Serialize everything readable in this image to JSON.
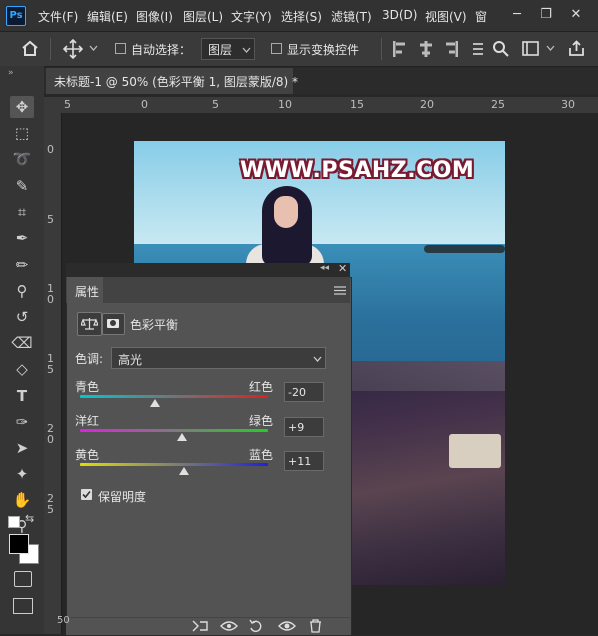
{
  "app": {
    "logo": "Ps"
  },
  "menu": [
    "文件(F)",
    "编辑(E)",
    "图像(I)",
    "图层(L)",
    "文字(Y)",
    "选择(S)",
    "滤镜(T)",
    "3D(D)",
    "视图(V)",
    "窗"
  ],
  "window_controls": {
    "minimize": "─",
    "restore": "❐",
    "close": "✕"
  },
  "options": {
    "auto_select_label": "自动选择：",
    "auto_select_target": "图层",
    "show_transform_label": "显示变换控件"
  },
  "document": {
    "tab_title": "未标题-1 @ 50% (色彩平衡 1, 图层蒙版/8) *"
  },
  "rulers": {
    "h_ticks": [
      "5",
      "0",
      "5",
      "10",
      "15",
      "20",
      "25",
      "30"
    ],
    "v_ticks": [
      "0",
      "5",
      "1 0",
      "1 5",
      "2 0",
      "2 5"
    ],
    "corner": "50"
  },
  "canvas": {
    "watermark": "WWW.PSAHZ.COM"
  },
  "properties": {
    "tab_label": "属性",
    "adjustment_label": "色彩平衡",
    "tone_label": "色调:",
    "tone_value": "高光",
    "sliders": [
      {
        "left_label": "青色",
        "right_label": "红色",
        "value": "-20",
        "position": -20
      },
      {
        "left_label": "洋红",
        "right_label": "绿色",
        "value": "+9",
        "position": 9
      },
      {
        "left_label": "黄色",
        "right_label": "蓝色",
        "value": "+11",
        "position": 11
      }
    ],
    "preserve_label": "保留明度",
    "preserve_checked": true
  },
  "colors": {
    "accent": "#31a8ff",
    "cyan_red": [
      "#00c8d0",
      "#e02020"
    ],
    "magenta_green": [
      "#e020e0",
      "#20d020"
    ],
    "yellow_blue": [
      "#e0e000",
      "#2020e0"
    ]
  }
}
